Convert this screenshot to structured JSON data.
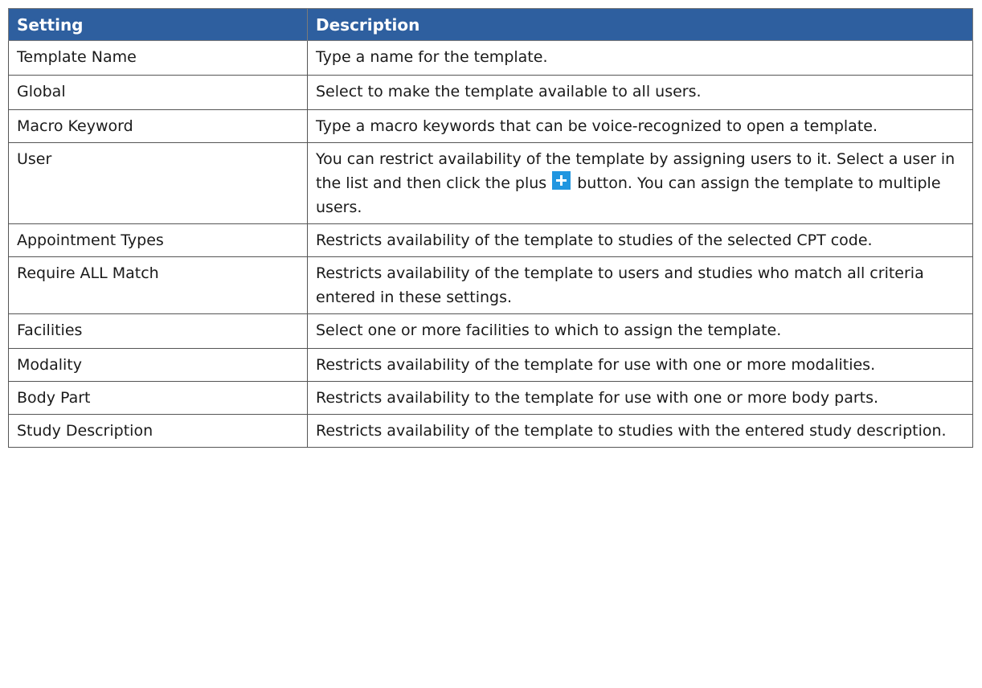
{
  "table": {
    "headers": {
      "setting": "Setting",
      "description": "Description"
    },
    "header_color": "#2e5f9f",
    "rows": [
      {
        "setting": "Template Name",
        "description": "Type a name for the template."
      },
      {
        "setting": "Global",
        "description": "Select to make the template available to all users."
      },
      {
        "setting": "Macro Keyword",
        "description": "Type a macro keywords that can be voice-recognized to open a template."
      },
      {
        "setting": "User",
        "description_before_icon": "You can restrict availability of the template by assigning users to it. Select a user in the list and then click the plus",
        "icon": "plus-icon",
        "icon_color": "#2196e0",
        "description_after_icon": "button. You can assign the template to multiple users."
      },
      {
        "setting": "Appointment Types",
        "description": "Restricts availability of the template to studies of the selected CPT code."
      },
      {
        "setting": "Require ALL Match",
        "description": "Restricts availability of the template to users and studies who match all criteria entered in these settings."
      },
      {
        "setting": "Facilities",
        "description": "Select one or more facilities to which to assign the template."
      },
      {
        "setting": "Modality",
        "description": "Restricts availability of the template for use with one or more modalities."
      },
      {
        "setting": "Body Part",
        "description": "Restricts availability to the template for use with one or more body parts."
      },
      {
        "setting": "Study Description",
        "description": "Restricts availability of the template to studies with the entered study description."
      }
    ]
  }
}
